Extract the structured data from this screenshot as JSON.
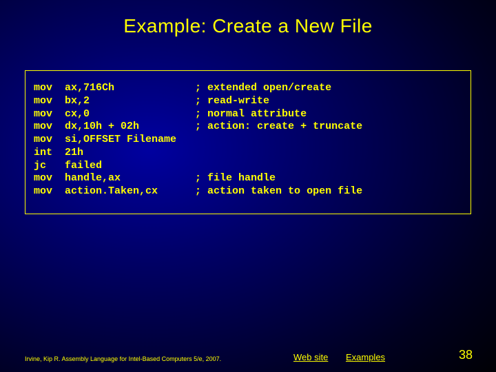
{
  "title": "Example: Create a New File",
  "code": "mov  ax,716Ch             ; extended open/create\nmov  bx,2                 ; read-write\nmov  cx,0                 ; normal attribute\nmov  dx,10h + 02h         ; action: create + truncate\nmov  si,OFFSET Filename\nint  21h\njc   failed\nmov  handle,ax            ; file handle\nmov  action.Taken,cx      ; action taken to open file",
  "footer": {
    "citation": "Irvine, Kip R. Assembly Language for Intel-Based Computers 5/e, 2007.",
    "link_web": "Web site",
    "link_examples": "Examples",
    "page": "38"
  }
}
